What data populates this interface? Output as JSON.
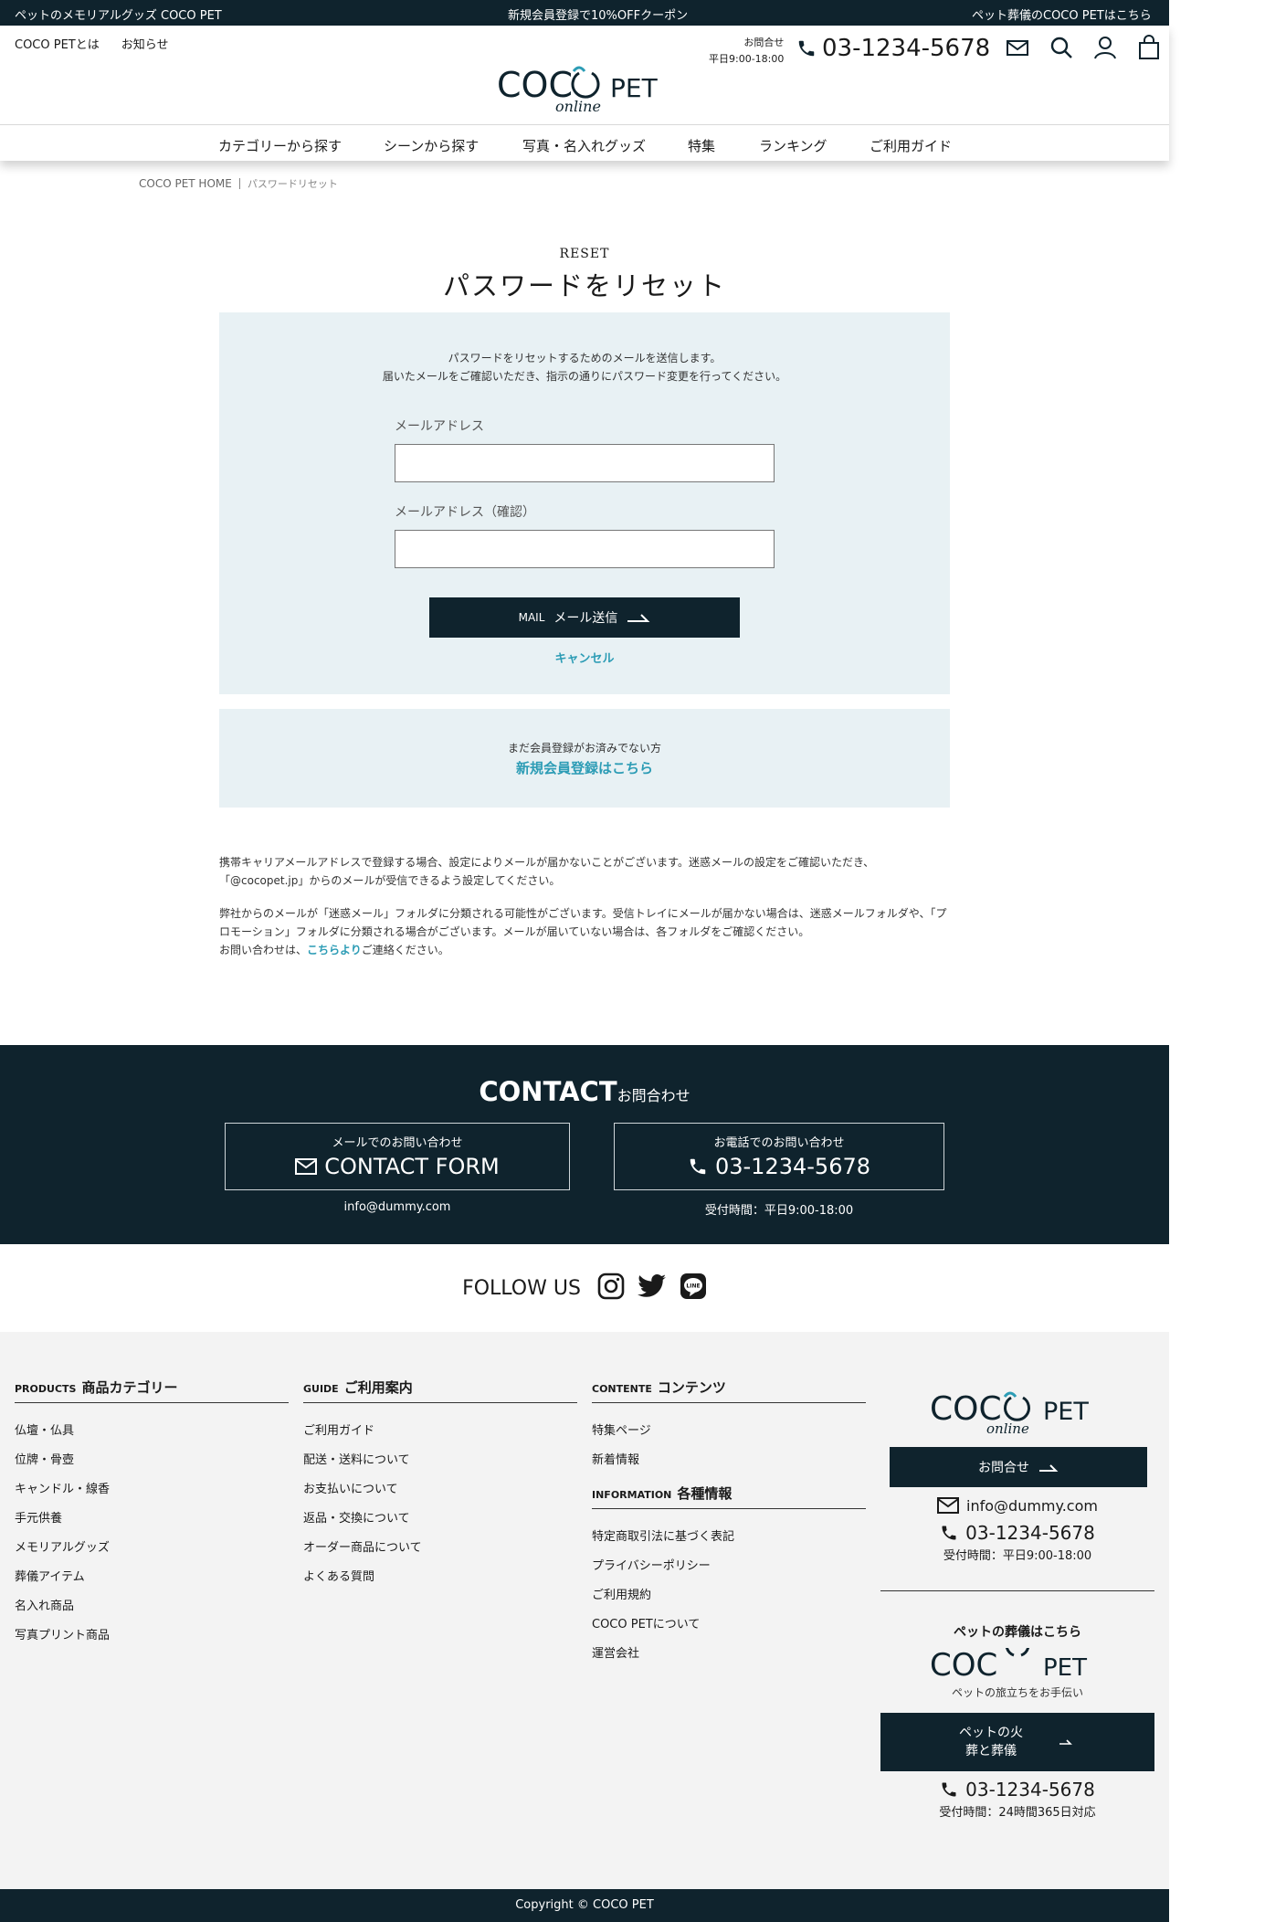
{
  "topbar": {
    "left": "ペットのメモリアルグッズ COCO PET",
    "center": "新規会員登録で10%OFFクーポン",
    "right": "ペット葬儀のCOCO PETはこちら"
  },
  "header": {
    "links": [
      "COCO PETとは",
      "お知らせ"
    ],
    "logo_main_a": "COC",
    "logo_main_b": "PET",
    "logo_sub": "online",
    "contact_label": "お問合せ",
    "contact_hours": "平日9:00-18:00",
    "phone": "03-1234-5678",
    "icons": [
      "mail-icon",
      "search-icon",
      "user-icon",
      "cart-icon"
    ]
  },
  "nav": [
    "カテゴリーから探す",
    "シーンから探す",
    "写真・名入れグッズ",
    "特集",
    "ランキング",
    "ご利用ガイド"
  ],
  "breadcrumb": {
    "home": "COCO PET HOME",
    "current": "パスワードリセット"
  },
  "reset": {
    "title_en": "RESET",
    "title_ja": "パスワードをリセット",
    "desc_1": "パスワードをリセットするためのメールを送信します。",
    "desc_2": "届いたメールをご確認いただき、指示の通りにパスワード変更を行ってください。",
    "email_label": "メールアドレス",
    "email_value": "",
    "email_confirm_label": "メールアドレス（確認）",
    "email_confirm_value": "",
    "submit_en": "MAIL",
    "submit_ja": "メール送信",
    "cancel": "キャンセル"
  },
  "register": {
    "question": "まだ会員登録がお済みでない方",
    "link": "新規会員登録はこちら"
  },
  "notes": {
    "p1": "携帯キャリアメールアドレスで登録する場合、設定によりメールが届かないことがございます。迷惑メールの設定をご確認いただき、「@cocopet.jp」からのメールが受信できるよう設定してください。",
    "p2a": "弊社からのメールが「迷惑メール」フォルダに分類される可能性がございます。受信トレイにメールが届かない場合は、迷惑メールフォルダや、「プロモーション」フォルダに分類される場合がございます。メールが届いていない場合は、各フォルダをご確認ください。",
    "p2b": "お問い合わせは、",
    "p2link": "こちらより",
    "p2c": "ご連絡ください。"
  },
  "contact": {
    "title_en": "CONTACT",
    "title_ja": "お問合わせ",
    "mail_small": "メールでのお問い合わせ",
    "mail_big": "CONTACT FORM",
    "mail_sub": "info@dummy.com",
    "tel_small": "お電話でのお問い合わせ",
    "tel_big": "03-1234-5678",
    "tel_sub": "受付時間：平日9:00-18:00"
  },
  "follow": {
    "label": "FOLLOW US",
    "icons": [
      "instagram-icon",
      "twitter-icon",
      "line-icon"
    ]
  },
  "footer": {
    "products": {
      "en": "PRODUCTS",
      "ja": "商品カテゴリー",
      "items": [
        "仏壇・仏具",
        "位牌・骨壺",
        "キャンドル・線香",
        "手元供養",
        "メモリアルグッズ",
        "葬儀アイテム",
        "名入れ商品",
        "写真プリント商品"
      ]
    },
    "guide": {
      "en": "GUIDE",
      "ja": "ご利用案内",
      "items": [
        "ご利用ガイド",
        "配送・送料について",
        "お支払いについて",
        "返品・交換について",
        "オーダー商品について",
        "よくある質問"
      ]
    },
    "contents": {
      "en": "CONTENTE",
      "ja": "コンテンツ",
      "items": [
        "特集ページ",
        "新着情報"
      ]
    },
    "information": {
      "en": "INFORMATION",
      "ja": "各種情報",
      "items": [
        "特定商取引法に基づく表記",
        "プライバシーポリシー",
        "ご利用規約",
        "COCO PETについて",
        "運営会社"
      ]
    },
    "right": {
      "contact_btn": "お問合せ",
      "email": "info@dummy.com",
      "phone": "03-1234-5678",
      "hours": "受付時間：平日9:00-18:00",
      "funeral_heading": "ペットの葬儀はこちら",
      "funeral_logo_a": "COC",
      "funeral_logo_b": "PET",
      "funeral_tagline": "ペットの旅立ちをお手伝い",
      "funeral_btn_1": "ペットの火",
      "funeral_btn_2": "葬と葬儀",
      "funeral_phone": "03-1234-5678",
      "funeral_hours": "受付時間：24時間365日対応"
    }
  },
  "copyright": "Copyright © COCO PET",
  "colors": {
    "navy": "#0f232d",
    "accent": "#2c9cb5",
    "panel": "#e8f1f4",
    "footer_bg": "#f3f3f3"
  }
}
